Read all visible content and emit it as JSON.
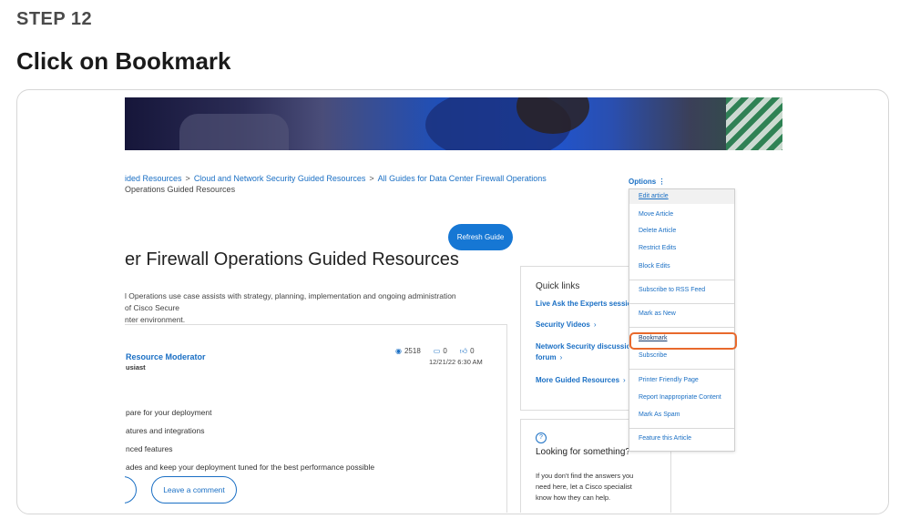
{
  "step": {
    "label": "STEP 12",
    "title": "Click on Bookmark"
  },
  "breadcrumb": {
    "items": [
      "ided Resources",
      "Cloud and Network Security Guided Resources",
      "All Guides for Data Center Firewall Operations"
    ],
    "separator": ">",
    "current": "Operations Guided Resources"
  },
  "page": {
    "refresh_label": "Refresh Guide",
    "headline": "er Firewall Operations Guided Resources",
    "description_line1": "l Operations use case assists with strategy, planning, implementation and ongoing administration of Cisco Secure",
    "description_line2": "nter environment."
  },
  "post": {
    "author": "Resource Moderator",
    "rank": "usiast",
    "views": "2518",
    "comments": "0",
    "likes": "0",
    "date": "12/21/22 6:30 AM",
    "bullets": [
      "pare for your deployment",
      "atures and integrations",
      "nced features",
      "ades and keep your deployment tuned for the best performance possible"
    ],
    "left_button": "il",
    "comment_button": "Leave a comment"
  },
  "quick_links": {
    "title": "Quick links",
    "items": [
      "Live Ask the Experts sessio",
      "Security Videos",
      "Network Security discussio",
      "forum",
      "More Guided Resources"
    ]
  },
  "looking": {
    "icon": "?",
    "title": "Looking for something?",
    "text_line1": "If you don't find the answers you",
    "text_line2": "need here, let a Cisco specialist",
    "text_line3": "know how they can help."
  },
  "options": {
    "label": "Options",
    "items": [
      "Edit article",
      "Move Article",
      "Delete Article",
      "Restrict Edits",
      "Block Edits",
      "Subscribe to RSS Feed",
      "Mark as New",
      "Bookmark",
      "Subscribe",
      "Printer Friendly Page",
      "Report Inappropriate Content",
      "Mark As Spam",
      "Feature this Article"
    ]
  },
  "colors": {
    "link": "#1a6fc4",
    "button": "#1677d4",
    "highlight": "#e8692c"
  },
  "icons": [
    "eye-icon",
    "comment-icon",
    "thumbs-up-icon",
    "chevron-right-icon",
    "question-icon",
    "kebab-icon"
  ]
}
